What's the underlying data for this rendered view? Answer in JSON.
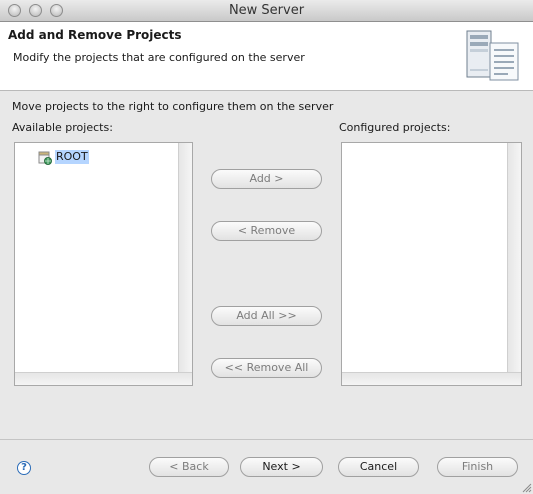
{
  "window": {
    "title": "New Server"
  },
  "header": {
    "title": "Add and Remove Projects",
    "description": "Modify the projects that are configured on the server"
  },
  "main": {
    "instruction": "Move projects to the right to configure them on the server",
    "available_label": "Available projects:",
    "configured_label": "Configured projects:",
    "available_projects": [
      {
        "label": "ROOT",
        "icon": "web-project-icon",
        "selected": true
      }
    ],
    "configured_projects": []
  },
  "buttons": {
    "add": "Add >",
    "remove": "< Remove",
    "add_all": "Add All >>",
    "remove_all": "<< Remove All"
  },
  "footer": {
    "help": "?",
    "back": "< Back",
    "next": "Next >",
    "cancel": "Cancel",
    "finish": "Finish"
  },
  "colors": {
    "selection": "#b5d5ff",
    "help_accent": "#2b6cb8"
  }
}
